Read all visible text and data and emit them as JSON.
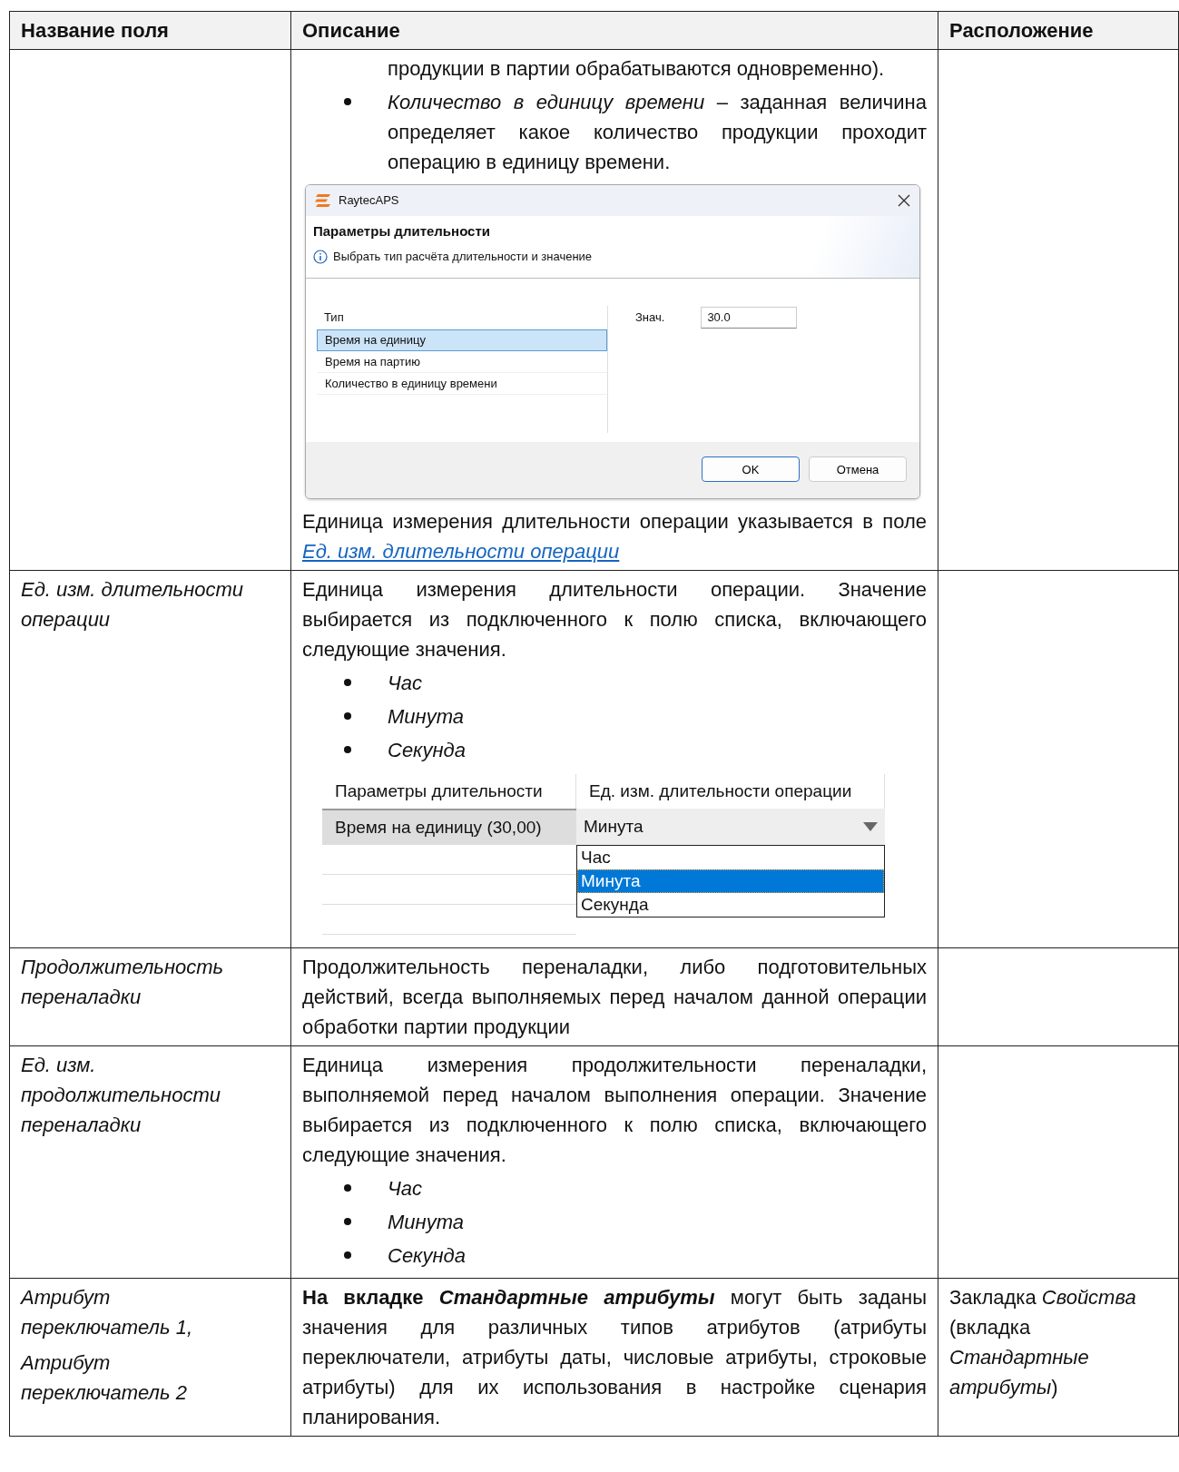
{
  "table": {
    "columns": [
      "Название поля",
      "Описание",
      "Расположение"
    ],
    "rows": [
      {
        "field": [],
        "location": "",
        "blocks": [
          {
            "kind": "continuation",
            "text": "продукции в партии обрабатываются одновременно)."
          },
          {
            "kind": "bullets",
            "items": [
              "*Количество в единицу времени* – заданная величина определяет какое количество продукции проходит операцию в единицу времени."
            ]
          },
          {
            "kind": "dialog",
            "app": "RaytecAPS",
            "heading": "Параметры длительности",
            "info": "Выбрать тип расчёта длительности и значение",
            "list_header": "Тип",
            "options": [
              {
                "label": "Время на единицу",
                "selected": true
              },
              {
                "label": "Время на партию",
                "selected": false
              },
              {
                "label": "Количество в единицу времени",
                "selected": false
              }
            ],
            "value_label": "Знач.",
            "value": "30.0",
            "buttons": [
              {
                "label": "OK",
                "default": true
              },
              {
                "label": "Отмена",
                "default": false
              }
            ]
          },
          {
            "kind": "paragraph",
            "text": "Единица измерения длительности операции указывается в поле",
            "link": "Ед. изм. длительности операции"
          }
        ]
      },
      {
        "field": [
          "Ед. изм. длительности операции"
        ],
        "location": "",
        "blocks": [
          {
            "kind": "paragraph",
            "text": "Единица измерения длительности операции. Значение выбирается из подключенного к полю списка, включающего следующие значения."
          },
          {
            "kind": "bullets",
            "items": [
              "*Час*",
              "*Минута*",
              "*Секунда*"
            ]
          },
          {
            "kind": "grid",
            "columns": [
              "Параметры длительности",
              "Ед. изм. длительности операции"
            ],
            "cell": "Время на единицу (30,00)",
            "combo": "Минута",
            "options": [
              {
                "label": "Час",
                "selected": false
              },
              {
                "label": "Минута",
                "selected": true
              },
              {
                "label": "Секунда",
                "selected": false
              }
            ]
          }
        ]
      },
      {
        "field": [
          "Продолжительность переналадки"
        ],
        "location": "",
        "blocks": [
          {
            "kind": "paragraph",
            "text": "Продолжительность переналадки, либо подготовительных действий, всегда выполняемых перед началом данной операции обработки партии продукции"
          }
        ]
      },
      {
        "field": [
          "Ед. изм. продолжительности переналадки"
        ],
        "location": "",
        "blocks": [
          {
            "kind": "paragraph",
            "text": "Единица измерения продолжительности переналадки, выполняемой перед началом выполнения операции. Значение выбирается из подключенного к полю списка, включающего следующие значения."
          },
          {
            "kind": "bullets",
            "items": [
              "*Час*",
              "*Минута*",
              "*Секунда*"
            ]
          }
        ]
      },
      {
        "field": [
          "Атрибут переключатель 1,",
          "Атрибут переключатель 2"
        ],
        "location": "Закладка *Свойства* (вкладка *Стандартные атрибуты*)",
        "blocks": [
          {
            "kind": "paragraph",
            "lead": "На вкладке *Стандартные атрибуты*",
            "text": "могут быть заданы значения для различных типов атрибутов (атрибуты переключатели, атрибуты даты, числовые атрибуты, строковые атрибуты) для их использования в настройке сценария планирования."
          }
        ]
      }
    ]
  }
}
